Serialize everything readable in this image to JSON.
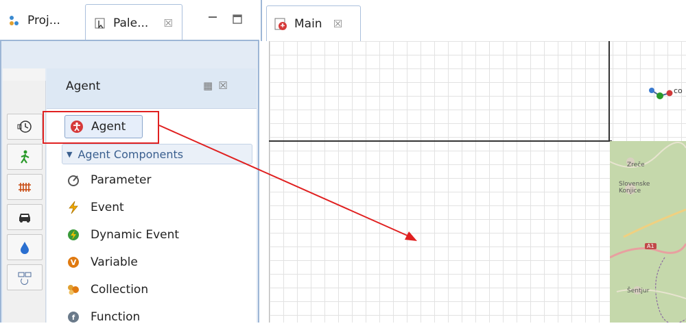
{
  "left_tabs": {
    "projects_label": "Proj...",
    "palette_label": "Pale...",
    "close_glyph": "☒"
  },
  "palette": {
    "title": "Agent",
    "selected_item": "Agent",
    "section_label": "Agent Components",
    "items": [
      {
        "label": "Parameter",
        "icon": "parameter-icon"
      },
      {
        "label": "Event",
        "icon": "event-icon"
      },
      {
        "label": "Dynamic Event",
        "icon": "dynamic-event-icon"
      },
      {
        "label": "Variable",
        "icon": "variable-icon"
      },
      {
        "label": "Collection",
        "icon": "collection-icon"
      },
      {
        "label": "Function",
        "icon": "function-icon"
      }
    ]
  },
  "editor": {
    "tab_label": "Main",
    "connections_label": "co"
  },
  "map": {
    "place_1": "Zreče",
    "place_2_line1": "Slovenske",
    "place_2_line2": "Konjice",
    "road": "A1",
    "place_3": "Šentjur"
  },
  "colors": {
    "highlight": "#e02020",
    "arrow": "#e02020",
    "agent_icon": "#d63a3a",
    "section_text": "#3a5f8f"
  }
}
